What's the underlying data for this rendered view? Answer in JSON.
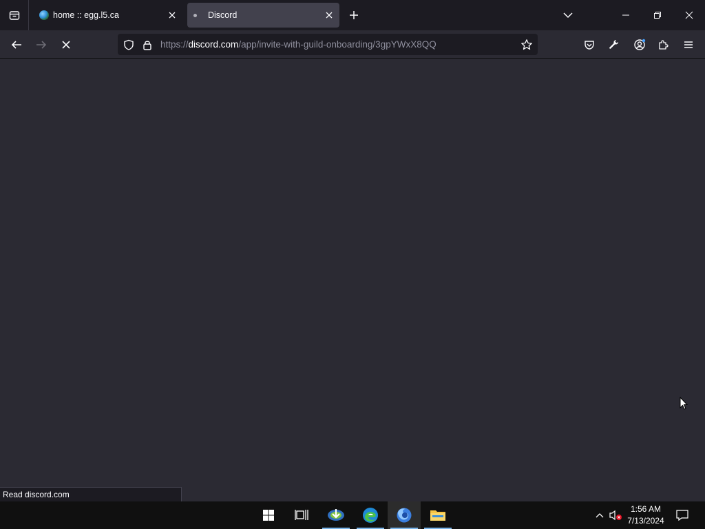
{
  "tabs": [
    {
      "title": "home :: egg.l5.ca",
      "icon": "globe-icon"
    },
    {
      "title": "Discord",
      "icon": "loading-dot-icon",
      "active": true
    }
  ],
  "navbar": {
    "url_prefix": "https://",
    "url_host": "discord.com",
    "url_path": "/app/invite-with-guild-onboarding/3gpYWxX8QQ"
  },
  "status_text": "Read discord.com",
  "taskbar": {
    "time": "1:56 AM",
    "date": "7/13/2024",
    "apps": [
      "windows-start-icon",
      "task-view-icon",
      "download-manager-icon",
      "edge-icon",
      "firefox-icon",
      "file-explorer-icon"
    ]
  },
  "colors": {
    "tabstrip": "#1c1b22",
    "toolbar": "#2b2a33",
    "active_tab": "#42414d",
    "taskbar": "#101010"
  }
}
